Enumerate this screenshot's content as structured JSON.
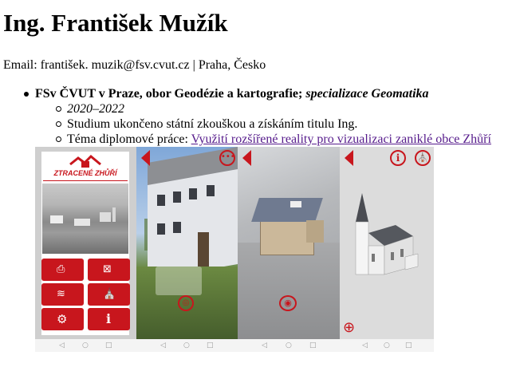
{
  "name": "Ing. František Mužík",
  "contact": {
    "email_prefix": "Email:",
    "email": "františek. muzik@fsv.cvut.cz",
    "sep": "|",
    "location": "Praha, Česko"
  },
  "education": {
    "school": "FSv ČVUT v Praze, obor Geodézie a kartografie;",
    "specialization": "specializace Geomatika",
    "years": "2020–2022",
    "completion": "Studium ukončeno státní zkouškou a získáním titulu Ing.",
    "thesis_label": "Téma diplomové práce:",
    "thesis_title": "Využití rozšířené reality pro vizualizaci zaniklé obce Zhůří"
  },
  "app": {
    "logo_text": "ZTRACENÉ ZHŮŘÍ",
    "colors": {
      "brand_red": "#c8161d"
    },
    "menu_icons": [
      "ar-photo-icon",
      "map-icon",
      "scroll-icon",
      "church-icon",
      "gear-icon",
      "info-icon"
    ],
    "nav_glyphs": {
      "back": "◁",
      "home": "○",
      "recent": "□"
    }
  }
}
